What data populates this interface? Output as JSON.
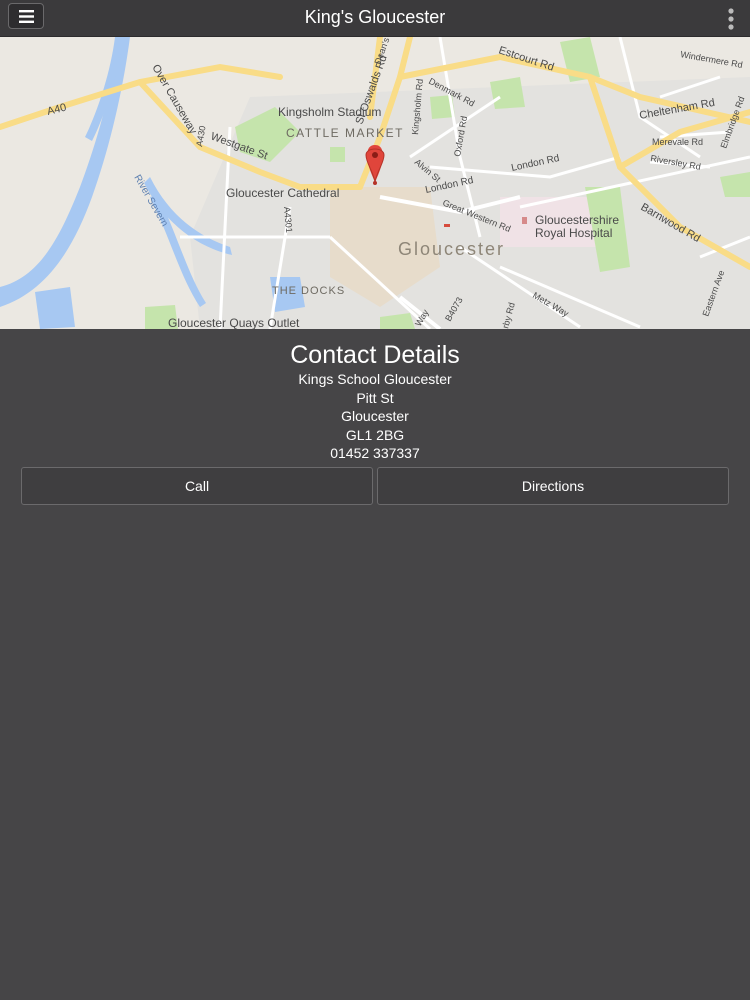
{
  "header": {
    "title": "King's Gloucester",
    "menu_icon": "hamburger-menu-icon",
    "more_icon": "more-vertical-icon"
  },
  "map": {
    "labels": {
      "a40": "A40",
      "over_causeway": "Over Causeway",
      "westgate": "Westgate St",
      "st_oswalds": "St Oswalds Rd",
      "deans_way": "Dean's Way",
      "kingsholm_rd": "Kingsholm Rd",
      "estcourt": "Estcourt Rd",
      "windermere": "Windermere Rd",
      "kingsholm_stadium": "Kingsholm Stadium",
      "cattle_market": "CATTLE MARKET",
      "denmark": "Denmark Rd",
      "oxford": "Oxford Rd",
      "cheltenham": "Cheltenham Rd",
      "merevale": "Merevale Rd",
      "riversley": "Riversley Rd",
      "elmbridge": "Elmbridge Rd",
      "alvin": "Alvin St",
      "london_rd1": "London Rd",
      "london_rd2": "London Rd",
      "a430": "A430",
      "river_severn": "River Severn",
      "cathedral": "Gloucester Cathedral",
      "great_western": "Great Western Rd",
      "hospital_line1": "Gloucestershire",
      "hospital_line2": "Royal Hospital",
      "barnwood": "Barnwood Rd",
      "gloucester": "Gloucester",
      "a4301": "A4301",
      "the_docks": "THE DOCKS",
      "eastern_ave": "Eastern Ave",
      "metz_way": "Metz Way",
      "b4073": "B4073",
      "bruton_way": "Way",
      "derby": "rby Rd",
      "quays": "Gloucester Quays Outlet"
    },
    "colors": {
      "road_major": "#fce08a",
      "road_minor": "#ffffff",
      "water": "#a7c8f2",
      "park": "#bfe3a6",
      "marker": "#e0453b"
    }
  },
  "contact": {
    "heading": "Contact Details",
    "name": "Kings School Gloucester",
    "street": "Pitt St",
    "city": "Gloucester",
    "postcode": "GL1 2BG",
    "phone": "01452 337337"
  },
  "actions": {
    "call_label": "Call",
    "directions_label": "Directions"
  }
}
